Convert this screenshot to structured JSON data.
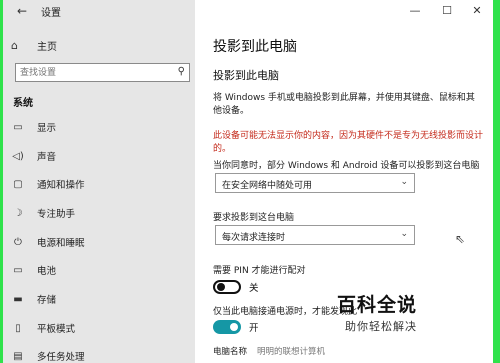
{
  "window": {
    "title": "设置",
    "back_icon": "back-arrow-icon",
    "controls": [
      "—",
      "☐",
      "✕"
    ]
  },
  "sidebar": {
    "home_label": "主页",
    "search_placeholder": "查找设置",
    "category": "系统",
    "items": [
      {
        "label": "显示",
        "icon": "display-icon"
      },
      {
        "label": "声音",
        "icon": "speaker-icon"
      },
      {
        "label": "通知和操作",
        "icon": "notification-icon"
      },
      {
        "label": "专注助手",
        "icon": "moon-icon"
      },
      {
        "label": "电源和睡眠",
        "icon": "power-icon"
      },
      {
        "label": "电池",
        "icon": "battery-icon"
      },
      {
        "label": "存储",
        "icon": "storage-icon"
      },
      {
        "label": "平板模式",
        "icon": "tablet-mode-icon"
      },
      {
        "label": "多任务处理",
        "icon": "multitask-icon"
      }
    ]
  },
  "main": {
    "page_title": "投影到此电脑",
    "section_title": "投影到此电脑",
    "description": "将 Windows 手机或电脑投影到此屏幕，并使用其键盘、鼠标和其他设备。",
    "warning": "此设备可能无法显示你的内容，因为其硬件不是专为无线投影而设计的。",
    "consent_label": "当你同意时，部分 Windows 和 Android 设备可以投影到这台电脑",
    "consent_value": "在安全网络中随处可用",
    "request_label": "要求投影到这台电脑",
    "request_value": "每次请求连接时",
    "pin_label": "需要 PIN 才能进行配对",
    "pin_toggle": "关",
    "power_label": "仅当此电脑接通电源时，才能发现此",
    "power_toggle": "开",
    "pc_name_label": "电脑名称",
    "pc_name_value": "明明的联想计算机"
  },
  "watermark": {
    "big": "百科全说",
    "small": "助你轻松解决"
  }
}
